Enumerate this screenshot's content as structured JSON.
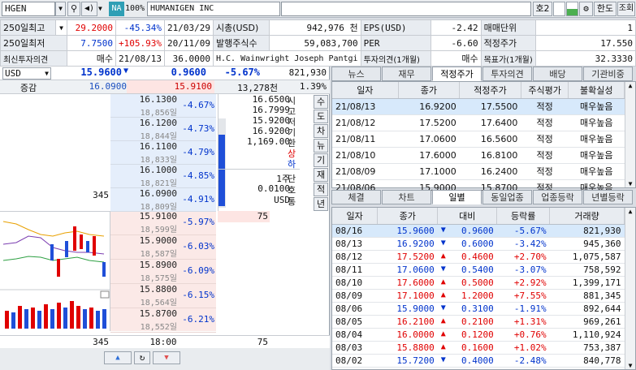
{
  "toolbar": {
    "code": "HGEN",
    "na": "NA",
    "pct": "100%",
    "name": "HUMANIGEN INC",
    "ho": "호2",
    "lang": "한도",
    "query": "조회"
  },
  "summary": {
    "rows": [
      [
        "250일최고",
        "29.2000",
        "-45.34%",
        "21/03/29",
        "시총(USD)",
        "942,976 천",
        "EPS(USD)",
        "-2.42",
        "매매단위",
        "1"
      ],
      [
        "250일최저",
        "7.7500",
        "+105.93%",
        "20/11/09",
        "발행주식수",
        "59,083,700",
        "PER",
        "-6.60",
        "적정주가",
        "17.550"
      ],
      [
        "최신투자의견",
        "매수",
        "21/08/13",
        "36.0000",
        "H.C. Wainwright Joseph Pantgi",
        "",
        "투자의견(1개월)",
        "매수",
        "목표가(1개월)",
        "32.3330"
      ]
    ]
  },
  "quote": {
    "currency": "USD",
    "price": "15.9600",
    "change": "0.9600",
    "pct": "-5.67%",
    "volume": "821,930",
    "label": "증감",
    "bid_total": "16.0900",
    "ask_total": "15.9100",
    "total_vol": "13,278천",
    "ratio": "1.39%"
  },
  "asks": [
    {
      "price": "16.1300",
      "qty": "18,856일",
      "pct": "-4.67%"
    },
    {
      "price": "16.1200",
      "qty": "18,844일",
      "pct": "-4.73%"
    },
    {
      "price": "16.1100",
      "qty": "18,833일",
      "pct": "-4.79%"
    },
    {
      "price": "16.1000",
      "qty": "18,821일",
      "pct": "-4.85%"
    },
    {
      "price": "16.0900",
      "qty": "18,809일",
      "pct": "-4.91%",
      "left": "345"
    }
  ],
  "bids": [
    {
      "price": "15.9100",
      "qty": "18,599일",
      "pct": "-5.97%",
      "right": "75"
    },
    {
      "price": "15.9000",
      "qty": "18,587일",
      "pct": "-6.03%"
    },
    {
      "price": "15.8900",
      "qty": "18,575일",
      "pct": "-6.09%"
    },
    {
      "price": "15.8800",
      "qty": "18,564일",
      "pct": "-6.15%"
    },
    {
      "price": "15.8700",
      "qty": "18,552일",
      "pct": "-6.21%"
    }
  ],
  "info_prices": [
    "16.6500",
    "16.7999",
    "15.9200",
    "16.9200",
    "1,169.00"
  ],
  "info_labels": [
    "시",
    "고",
    "저",
    "기",
    "환",
    "상",
    "하"
  ],
  "info_lower": [
    "1주",
    "0.0100",
    "USD"
  ],
  "info_lower_labels": [
    "단",
    "호",
    "통"
  ],
  "side_btns": [
    "수",
    "도",
    "차",
    "뉴",
    "기",
    "재",
    "적",
    "년"
  ],
  "bottom_left": "345",
  "bottom_time": "18:00",
  "bottom_right": "75",
  "tabs_top": [
    "뉴스",
    "재무",
    "적정주가",
    "투자의견",
    "배당",
    "기관비중"
  ],
  "fair": {
    "headers": [
      "일자",
      "종가",
      "적정주가",
      "주식평가",
      "불확실성"
    ],
    "rows": [
      [
        "21/08/13",
        "16.9200",
        "17.5500",
        "적정",
        "매우높음"
      ],
      [
        "21/08/12",
        "17.5200",
        "17.6400",
        "적정",
        "매우높음"
      ],
      [
        "21/08/11",
        "17.0600",
        "16.5600",
        "적정",
        "매우높음"
      ],
      [
        "21/08/10",
        "17.6000",
        "16.8100",
        "적정",
        "매우높음"
      ],
      [
        "21/08/09",
        "17.1000",
        "16.2400",
        "적정",
        "매우높음"
      ],
      [
        "21/08/06",
        "15.9000",
        "15.8700",
        "적정",
        "매우높음"
      ]
    ]
  },
  "tabs_bottom": [
    "체결",
    "차트",
    "일별",
    "동일업종",
    "업종등락",
    "년별등락"
  ],
  "daily": {
    "headers": [
      "일자",
      "종가",
      "대비",
      "등락률",
      "거래량"
    ],
    "rows": [
      {
        "d": "08/16",
        "c": "15.9600",
        "dir": "dn",
        "v": "0.9600",
        "p": "-5.67%",
        "vol": "821,930"
      },
      {
        "d": "08/13",
        "c": "16.9200",
        "dir": "dn",
        "v": "0.6000",
        "p": "-3.42%",
        "vol": "945,360"
      },
      {
        "d": "08/12",
        "c": "17.5200",
        "dir": "up",
        "v": "0.4600",
        "p": "+2.70%",
        "vol": "1,075,587"
      },
      {
        "d": "08/11",
        "c": "17.0600",
        "dir": "dn",
        "v": "0.5400",
        "p": "-3.07%",
        "vol": "758,592"
      },
      {
        "d": "08/10",
        "c": "17.6000",
        "dir": "up",
        "v": "0.5000",
        "p": "+2.92%",
        "vol": "1,399,171"
      },
      {
        "d": "08/09",
        "c": "17.1000",
        "dir": "up",
        "v": "1.2000",
        "p": "+7.55%",
        "vol": "881,345"
      },
      {
        "d": "08/06",
        "c": "15.9000",
        "dir": "dn",
        "v": "0.3100",
        "p": "-1.91%",
        "vol": "892,644"
      },
      {
        "d": "08/05",
        "c": "16.2100",
        "dir": "up",
        "v": "0.2100",
        "p": "+1.31%",
        "vol": "969,261"
      },
      {
        "d": "08/04",
        "c": "16.0000",
        "dir": "up",
        "v": "0.1200",
        "p": "+0.76%",
        "vol": "1,110,924"
      },
      {
        "d": "08/03",
        "c": "15.8800",
        "dir": "up",
        "v": "0.1600",
        "p": "+1.02%",
        "vol": "753,387"
      },
      {
        "d": "08/02",
        "c": "15.7200",
        "dir": "dn",
        "v": "0.4000",
        "p": "-2.48%",
        "vol": "840,778"
      }
    ]
  }
}
